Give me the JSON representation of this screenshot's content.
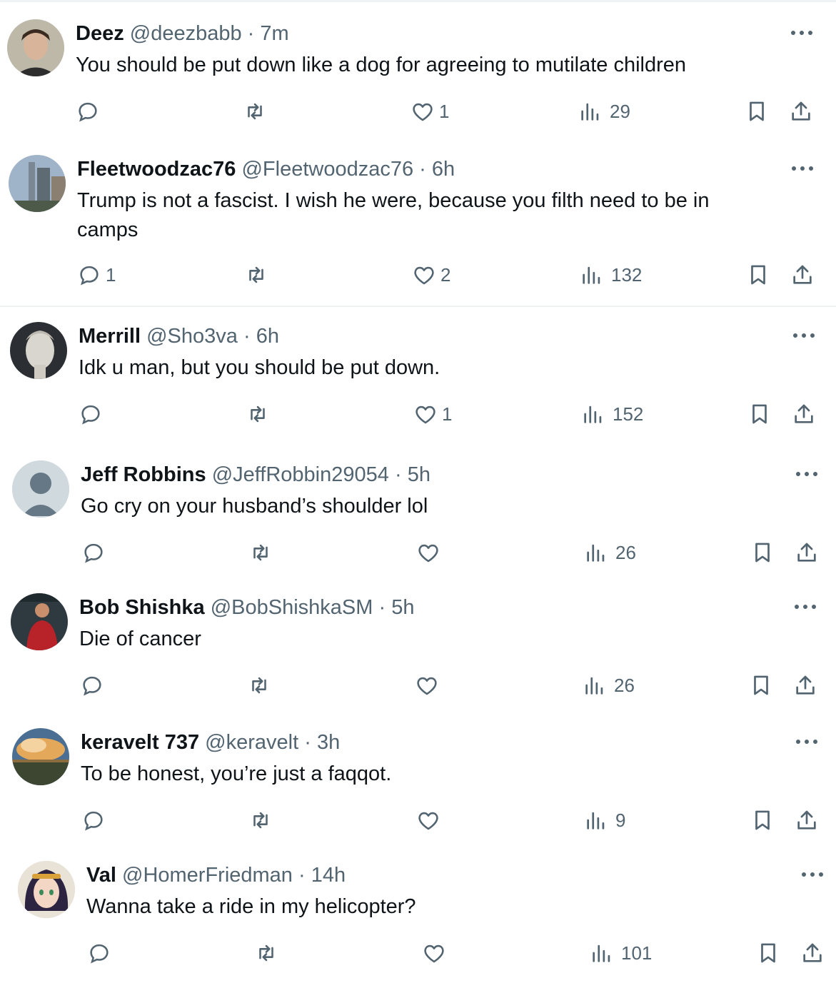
{
  "tweets": [
    {
      "name": "Deez",
      "handle": "@deezbabb",
      "time": "7m",
      "text": "You should be put down like a dog for agreeing to mutilate children",
      "replies": "",
      "likes": "1",
      "views": "29"
    },
    {
      "name": "Fleetwoodzac76",
      "handle": "@Fleetwoodzac76",
      "time": "6h",
      "text": "Trump is not a fascist. I wish he were, because you filth need to be in camps",
      "replies": "1",
      "likes": "2",
      "views": "132"
    },
    {
      "name": "Merrill",
      "handle": "@Sho3va",
      "time": "6h",
      "text": "Idk u man, but you should be put down.",
      "replies": "",
      "likes": "1",
      "views": "152"
    },
    {
      "name": "Jeff Robbins",
      "handle": "@JeffRobbin29054",
      "time": "5h",
      "text": "Go cry on your husband’s shoulder lol",
      "replies": "",
      "likes": "",
      "views": "26"
    },
    {
      "name": "Bob Shishka",
      "handle": "@BobShishkaSM",
      "time": "5h",
      "text": "Die of cancer",
      "replies": "",
      "likes": "",
      "views": "26"
    },
    {
      "name": "keravelt 737",
      "handle": "@keravelt",
      "time": "3h",
      "text": "To be honest, you’re just a faqqot.",
      "replies": "",
      "likes": "",
      "views": "9"
    },
    {
      "name": "Val",
      "handle": "@HomerFriedman",
      "time": "14h",
      "text": "Wanna take a ride in my helicopter?",
      "replies": "",
      "likes": "",
      "views": "101"
    }
  ],
  "separator": "·",
  "icons": {
    "reply": "reply-icon",
    "retweet": "retweet-icon",
    "like": "heart-icon",
    "views": "views-icon",
    "bookmark": "bookmark-icon",
    "share": "share-icon",
    "more": "more-icon"
  },
  "colors": {
    "text": "#0f1419",
    "secondary": "#536471",
    "divider": "#eff3f4"
  }
}
